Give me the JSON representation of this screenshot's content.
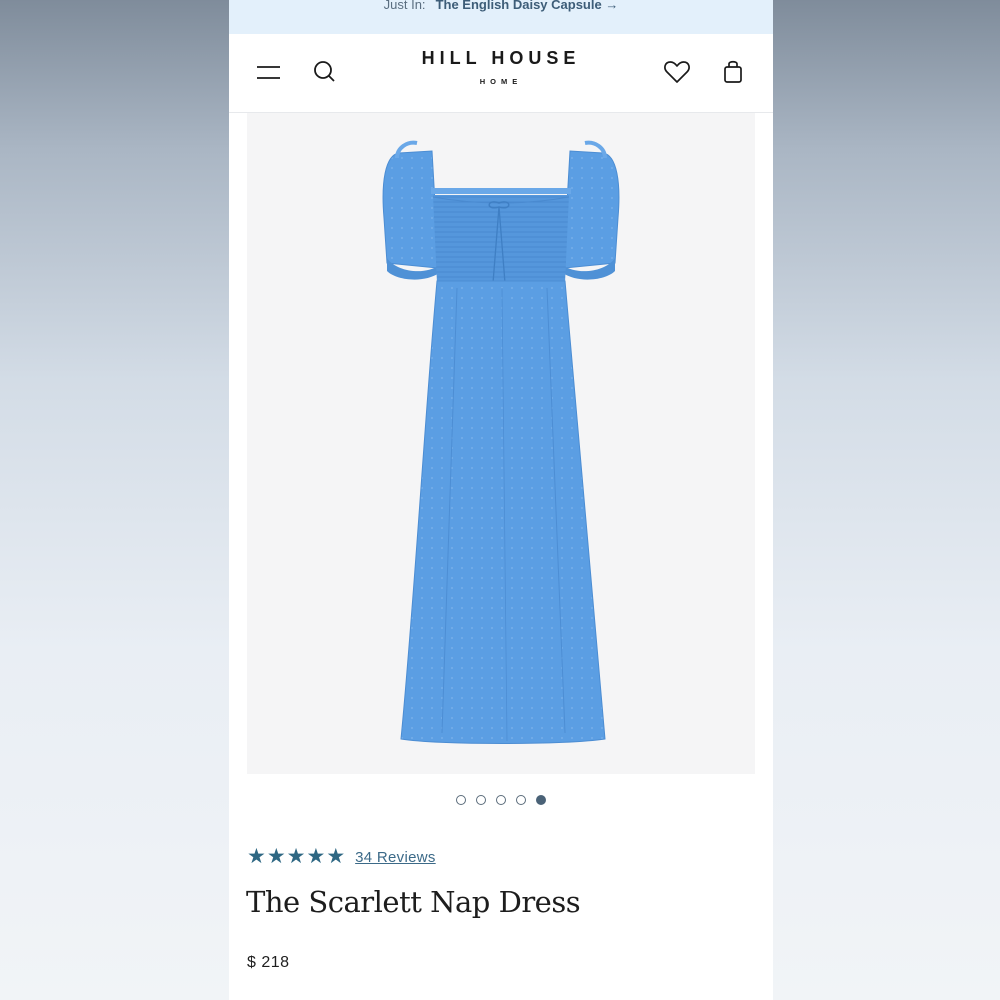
{
  "announcement": {
    "prefix": "Just In:",
    "link": "The English Daisy Capsule →"
  },
  "header": {
    "brand_name": "HILL HOUSE",
    "brand_sub": "HOME",
    "icons": [
      "menu-icon",
      "search-icon",
      "heart-icon",
      "bag-icon"
    ]
  },
  "product": {
    "image_alt_color": "#5b9ee3",
    "carousel": {
      "total": 5,
      "active_index": 4
    },
    "rating": {
      "stars": 5,
      "reviews_label": "34 Reviews"
    },
    "title": "The Scarlett Nap Dress",
    "price": "$ 218"
  },
  "colors": {
    "announcement_bg": "#e3f0fb",
    "star": "#2e6783",
    "dress": "#5b9ee3"
  }
}
